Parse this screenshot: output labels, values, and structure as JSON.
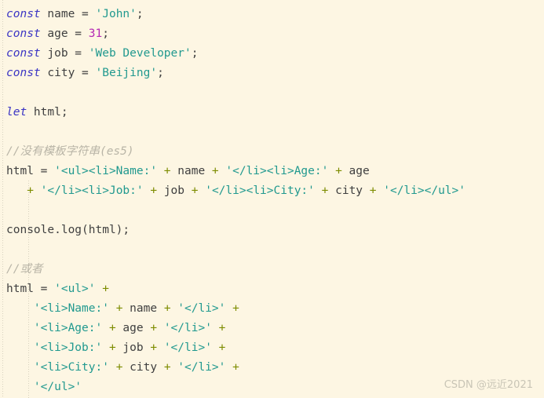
{
  "editor": {
    "language": "javascript",
    "theme_name": "solarized-light",
    "background_color": "#FDF6E3",
    "colors": {
      "keyword": "#3B35C4",
      "string": "#21998F",
      "number": "#B429B4",
      "operator": "#7D8C00",
      "plain": "#3F3F3F",
      "comment": "#B9B5A7",
      "watermark": "#C9C5B6"
    }
  },
  "code": {
    "lines": [
      {
        "id": 1,
        "tokens": [
          {
            "t": "const",
            "c": "kw"
          },
          {
            "t": " name = ",
            "c": "pln"
          },
          {
            "t": "'John'",
            "c": "str"
          },
          {
            "t": ";",
            "c": "pun"
          }
        ]
      },
      {
        "id": 2,
        "tokens": [
          {
            "t": "const",
            "c": "kw"
          },
          {
            "t": " age = ",
            "c": "pln"
          },
          {
            "t": "31",
            "c": "num"
          },
          {
            "t": ";",
            "c": "pun"
          }
        ]
      },
      {
        "id": 3,
        "tokens": [
          {
            "t": "const",
            "c": "kw"
          },
          {
            "t": " job = ",
            "c": "pln"
          },
          {
            "t": "'Web Developer'",
            "c": "str"
          },
          {
            "t": ";",
            "c": "pun"
          }
        ]
      },
      {
        "id": 4,
        "tokens": [
          {
            "t": "const",
            "c": "kw"
          },
          {
            "t": " city = ",
            "c": "pln"
          },
          {
            "t": "'Beijing'",
            "c": "str"
          },
          {
            "t": ";",
            "c": "pun"
          }
        ]
      },
      {
        "id": 5,
        "tokens": []
      },
      {
        "id": 6,
        "tokens": [
          {
            "t": "let",
            "c": "kw"
          },
          {
            "t": " html;",
            "c": "pln"
          }
        ]
      },
      {
        "id": 7,
        "tokens": []
      },
      {
        "id": 8,
        "tokens": [
          {
            "t": "//没有模板字符串(es5)",
            "c": "com"
          }
        ]
      },
      {
        "id": 9,
        "tokens": [
          {
            "t": "html = ",
            "c": "pln"
          },
          {
            "t": "'<ul><li>Name:'",
            "c": "str"
          },
          {
            "t": " ",
            "c": "pln"
          },
          {
            "t": "+",
            "c": "op"
          },
          {
            "t": " name ",
            "c": "pln"
          },
          {
            "t": "+",
            "c": "op"
          },
          {
            "t": " ",
            "c": "pln"
          },
          {
            "t": "'</li><li>Age:'",
            "c": "str"
          },
          {
            "t": " ",
            "c": "pln"
          },
          {
            "t": "+",
            "c": "op"
          },
          {
            "t": " age",
            "c": "pln"
          }
        ]
      },
      {
        "id": 10,
        "tokens": [
          {
            "t": "   ",
            "c": "pln"
          },
          {
            "t": "+",
            "c": "op"
          },
          {
            "t": " ",
            "c": "pln"
          },
          {
            "t": "'</li><li>Job:'",
            "c": "str"
          },
          {
            "t": " ",
            "c": "pln"
          },
          {
            "t": "+",
            "c": "op"
          },
          {
            "t": " job ",
            "c": "pln"
          },
          {
            "t": "+",
            "c": "op"
          },
          {
            "t": " ",
            "c": "pln"
          },
          {
            "t": "'</li><li>City:'",
            "c": "str"
          },
          {
            "t": " ",
            "c": "pln"
          },
          {
            "t": "+",
            "c": "op"
          },
          {
            "t": " city ",
            "c": "pln"
          },
          {
            "t": "+",
            "c": "op"
          },
          {
            "t": " ",
            "c": "pln"
          },
          {
            "t": "'</li></ul>'",
            "c": "str"
          }
        ]
      },
      {
        "id": 11,
        "tokens": []
      },
      {
        "id": 12,
        "tokens": [
          {
            "t": "console.log(html);",
            "c": "pln"
          }
        ]
      },
      {
        "id": 13,
        "tokens": []
      },
      {
        "id": 14,
        "tokens": [
          {
            "t": "//或者",
            "c": "com"
          }
        ]
      },
      {
        "id": 15,
        "tokens": [
          {
            "t": "html = ",
            "c": "pln"
          },
          {
            "t": "'<ul>'",
            "c": "str"
          },
          {
            "t": " ",
            "c": "pln"
          },
          {
            "t": "+",
            "c": "op"
          }
        ]
      },
      {
        "id": 16,
        "tokens": [
          {
            "t": "    ",
            "c": "pln"
          },
          {
            "t": "'<li>Name:'",
            "c": "str"
          },
          {
            "t": " ",
            "c": "pln"
          },
          {
            "t": "+",
            "c": "op"
          },
          {
            "t": " name ",
            "c": "pln"
          },
          {
            "t": "+",
            "c": "op"
          },
          {
            "t": " ",
            "c": "pln"
          },
          {
            "t": "'</li>'",
            "c": "str"
          },
          {
            "t": " ",
            "c": "pln"
          },
          {
            "t": "+",
            "c": "op"
          }
        ]
      },
      {
        "id": 17,
        "tokens": [
          {
            "t": "    ",
            "c": "pln"
          },
          {
            "t": "'<li>Age:'",
            "c": "str"
          },
          {
            "t": " ",
            "c": "pln"
          },
          {
            "t": "+",
            "c": "op"
          },
          {
            "t": " age ",
            "c": "pln"
          },
          {
            "t": "+",
            "c": "op"
          },
          {
            "t": " ",
            "c": "pln"
          },
          {
            "t": "'</li>'",
            "c": "str"
          },
          {
            "t": " ",
            "c": "pln"
          },
          {
            "t": "+",
            "c": "op"
          }
        ]
      },
      {
        "id": 18,
        "tokens": [
          {
            "t": "    ",
            "c": "pln"
          },
          {
            "t": "'<li>Job:'",
            "c": "str"
          },
          {
            "t": " ",
            "c": "pln"
          },
          {
            "t": "+",
            "c": "op"
          },
          {
            "t": " job ",
            "c": "pln"
          },
          {
            "t": "+",
            "c": "op"
          },
          {
            "t": " ",
            "c": "pln"
          },
          {
            "t": "'</li>'",
            "c": "str"
          },
          {
            "t": " ",
            "c": "pln"
          },
          {
            "t": "+",
            "c": "op"
          }
        ]
      },
      {
        "id": 19,
        "tokens": [
          {
            "t": "    ",
            "c": "pln"
          },
          {
            "t": "'<li>City:'",
            "c": "str"
          },
          {
            "t": " ",
            "c": "pln"
          },
          {
            "t": "+",
            "c": "op"
          },
          {
            "t": " city ",
            "c": "pln"
          },
          {
            "t": "+",
            "c": "op"
          },
          {
            "t": " ",
            "c": "pln"
          },
          {
            "t": "'</li>'",
            "c": "str"
          },
          {
            "t": " ",
            "c": "pln"
          },
          {
            "t": "+",
            "c": "op"
          }
        ]
      },
      {
        "id": 20,
        "tokens": [
          {
            "t": "    ",
            "c": "pln"
          },
          {
            "t": "'</ul>'",
            "c": "str"
          }
        ]
      }
    ]
  },
  "watermark": {
    "text": "CSDN @远近2021"
  }
}
